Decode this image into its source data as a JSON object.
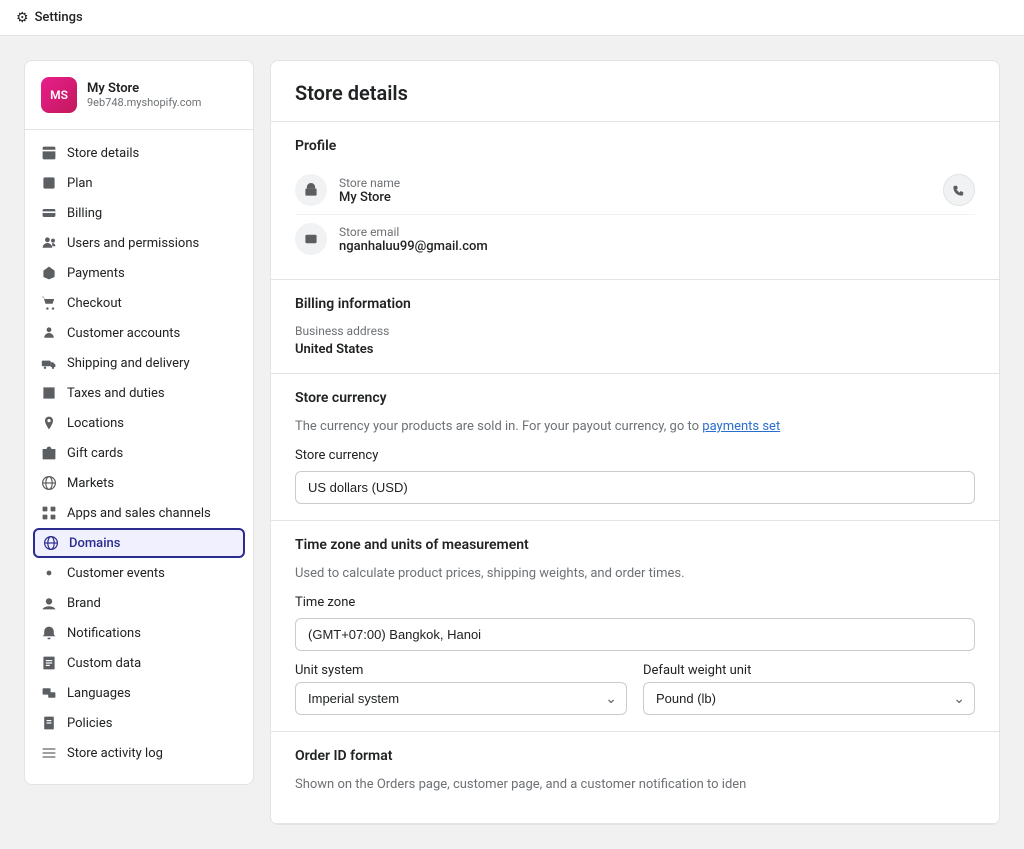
{
  "topbar": {
    "icon": "⚙",
    "title": "Settings"
  },
  "sidebar": {
    "store_avatar_initials": "MS",
    "store_name": "My Store",
    "store_url": "9eb748.myshopify.com",
    "nav_items": [
      {
        "id": "store-details",
        "label": "Store details",
        "icon": "🏪",
        "active": false,
        "icon_type": "store"
      },
      {
        "id": "plan",
        "label": "Plan",
        "icon": "📋",
        "active": false,
        "icon_type": "plan"
      },
      {
        "id": "billing",
        "label": "Billing",
        "icon": "💳",
        "active": false,
        "icon_type": "billing"
      },
      {
        "id": "users-permissions",
        "label": "Users and permissions",
        "icon": "👤",
        "active": false,
        "icon_type": "users"
      },
      {
        "id": "payments",
        "label": "Payments",
        "icon": "💰",
        "active": false,
        "icon_type": "payments"
      },
      {
        "id": "checkout",
        "label": "Checkout",
        "icon": "🛒",
        "active": false,
        "icon_type": "checkout"
      },
      {
        "id": "customer-accounts",
        "label": "Customer accounts",
        "icon": "👥",
        "active": false,
        "icon_type": "accounts"
      },
      {
        "id": "shipping-delivery",
        "label": "Shipping and delivery",
        "icon": "🚚",
        "active": false,
        "icon_type": "shipping"
      },
      {
        "id": "taxes-duties",
        "label": "Taxes and duties",
        "icon": "🏷",
        "active": false,
        "icon_type": "taxes"
      },
      {
        "id": "locations",
        "label": "Locations",
        "icon": "📍",
        "active": false,
        "icon_type": "location"
      },
      {
        "id": "gift-cards",
        "label": "Gift cards",
        "icon": "🎁",
        "active": false,
        "icon_type": "gift"
      },
      {
        "id": "markets",
        "label": "Markets",
        "icon": "🌐",
        "active": false,
        "icon_type": "markets"
      },
      {
        "id": "apps-sales",
        "label": "Apps and sales channels",
        "icon": "🔲",
        "active": false,
        "icon_type": "apps"
      },
      {
        "id": "domains",
        "label": "Domains",
        "icon": "🌐",
        "active": true,
        "icon_type": "domains"
      },
      {
        "id": "customer-events",
        "label": "Customer events",
        "icon": "🔧",
        "active": false,
        "icon_type": "events"
      },
      {
        "id": "brand",
        "label": "Brand",
        "icon": "🎨",
        "active": false,
        "icon_type": "brand"
      },
      {
        "id": "notifications",
        "label": "Notifications",
        "icon": "🔔",
        "active": false,
        "icon_type": "notifications"
      },
      {
        "id": "custom-data",
        "label": "Custom data",
        "icon": "📁",
        "active": false,
        "icon_type": "custom"
      },
      {
        "id": "languages",
        "label": "Languages",
        "icon": "💬",
        "active": false,
        "icon_type": "languages"
      },
      {
        "id": "policies",
        "label": "Policies",
        "icon": "📄",
        "active": false,
        "icon_type": "policies"
      },
      {
        "id": "store-activity",
        "label": "Store activity log",
        "icon": "≡",
        "active": false,
        "icon_type": "activity"
      }
    ]
  },
  "main": {
    "title": "Store details",
    "profile": {
      "section_title": "Profile",
      "store_name_label": "Store name",
      "store_name_value": "My Store",
      "store_email_label": "Store email",
      "store_email_value": "nganhaluu99@gmail.com"
    },
    "billing": {
      "section_title": "Billing information",
      "address_label": "Business address",
      "address_value": "United States"
    },
    "currency": {
      "section_title": "Store currency",
      "description": "The currency your products are sold in. For your payout currency, go to",
      "link_text": "payments set",
      "currency_label": "Store currency",
      "currency_value": "US dollars (USD)"
    },
    "timezone": {
      "section_title": "Time zone and units of measurement",
      "description": "Used to calculate product prices, shipping weights, and order times.",
      "timezone_label": "Time zone",
      "timezone_value": "(GMT+07:00) Bangkok, Hanoi",
      "unit_system_label": "Unit system",
      "unit_system_value": "Imperial system",
      "weight_label": "Default weight unit",
      "weight_value": "Pound (lb)"
    },
    "order_id": {
      "section_title": "Order ID format",
      "description": "Shown on the Orders page, customer page, and a customer notification to iden"
    }
  }
}
